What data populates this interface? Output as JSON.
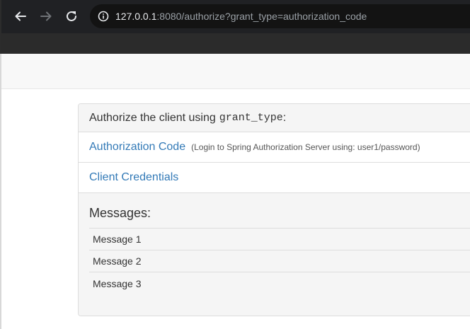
{
  "browser": {
    "url_host": "127.0.0.1",
    "url_rest": ":8080/authorize?grant_type=authorization_code",
    "icons": {
      "back": "back-arrow-icon",
      "forward": "forward-arrow-icon",
      "reload": "reload-icon",
      "info": "info-icon"
    }
  },
  "panel": {
    "heading_prefix": "Authorize the client using",
    "heading_code": "grant_type",
    "heading_suffix": ":",
    "options": [
      {
        "label": "Authorization Code",
        "note": "(Login to Spring Authorization Server using: user1/password)"
      },
      {
        "label": "Client Credentials",
        "note": ""
      }
    ]
  },
  "messages": {
    "title": "Messages:",
    "items": [
      "Message 1",
      "Message 2",
      "Message 3"
    ]
  },
  "colors": {
    "link": "#337ab7",
    "browser_bg": "#202124",
    "panel_bg": "#f5f5f5"
  }
}
